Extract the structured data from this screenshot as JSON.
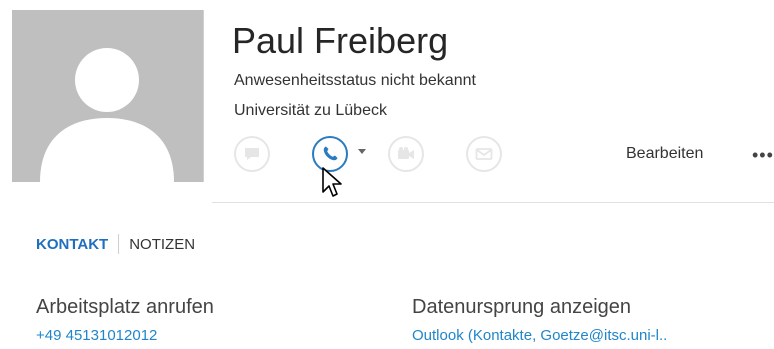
{
  "contact": {
    "name": "Paul Freiberg",
    "presence": "Anwesenheitsstatus nicht bekannt",
    "company": "Universität zu Lübeck"
  },
  "actions": {
    "edit_label": "Bearbeiten",
    "more_label": "•••",
    "buttons": [
      {
        "icon": "chat-bubble-icon",
        "state": "disabled"
      },
      {
        "icon": "phone-icon",
        "state": "active"
      },
      {
        "icon": "video-camera-icon",
        "state": "disabled"
      },
      {
        "icon": "email-icon",
        "state": "disabled"
      }
    ]
  },
  "tabs": [
    {
      "label": "KONTAKT",
      "active": true
    },
    {
      "label": "NOTIZEN",
      "active": false
    }
  ],
  "fields": {
    "work_phone": {
      "label": "Arbeitsplatz anrufen",
      "value": "+49 45131012012"
    },
    "source": {
      "label": "Datenursprung anzeigen",
      "value": "Outlook (Kontakte, Goetze@itsc.uni-l.."
    }
  },
  "colors": {
    "accent": "#1f6fbf",
    "link": "#1f86c9",
    "avatar_bg": "#bfbfbf",
    "disabled_icon": "#e6e6e6"
  }
}
